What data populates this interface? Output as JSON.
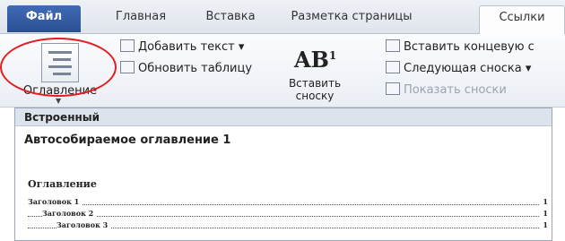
{
  "tabs": [
    {
      "label": "Файл"
    },
    {
      "label": "Главная"
    },
    {
      "label": "Вставка"
    },
    {
      "label": "Разметка страницы"
    },
    {
      "label": "Ссылки"
    }
  ],
  "ribbon": {
    "toc_label": "Оглавление",
    "add_text": "Добавить текст",
    "update_table": "Обновить таблицу",
    "footnote_icon_text": "AB",
    "footnote_icon_sup": "1",
    "insert_footnote_line1": "Вставить",
    "insert_footnote_line2": "сноску",
    "insert_endnote": "Вставить концевую с",
    "next_footnote": "Следующая сноска",
    "show_notes": "Показать сноски"
  },
  "dropdown": {
    "section": "Встроенный",
    "title": "Автособираемое оглавление 1",
    "preview_heading": "Оглавление",
    "lines": [
      {
        "text": "Заголовок 1",
        "page": "1"
      },
      {
        "text": "Заголовок 2",
        "page": "1"
      },
      {
        "text": "Заголовок 3",
        "page": "1"
      }
    ]
  }
}
